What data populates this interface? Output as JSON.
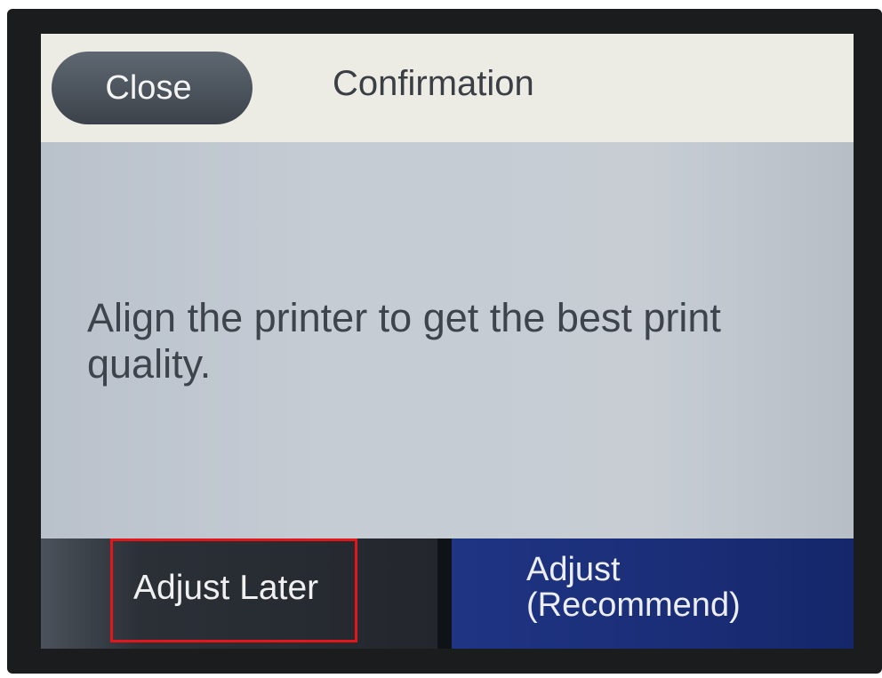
{
  "dialog": {
    "close_label": "Close",
    "title": "Confirmation",
    "message": "Align the printer to get the best print quality."
  },
  "actions": {
    "adjust_later_label": "Adjust Later",
    "adjust_label": "Adjust\n(Recommend)"
  },
  "colors": {
    "header_bg": "#ecebe4",
    "content_bg": "#c5ccd4",
    "close_button_bg": "#4b535c",
    "adjust_later_bg": "#23272d",
    "adjust_button_bg": "#1a2d76",
    "highlight_border": "#e3161b"
  },
  "icons": []
}
